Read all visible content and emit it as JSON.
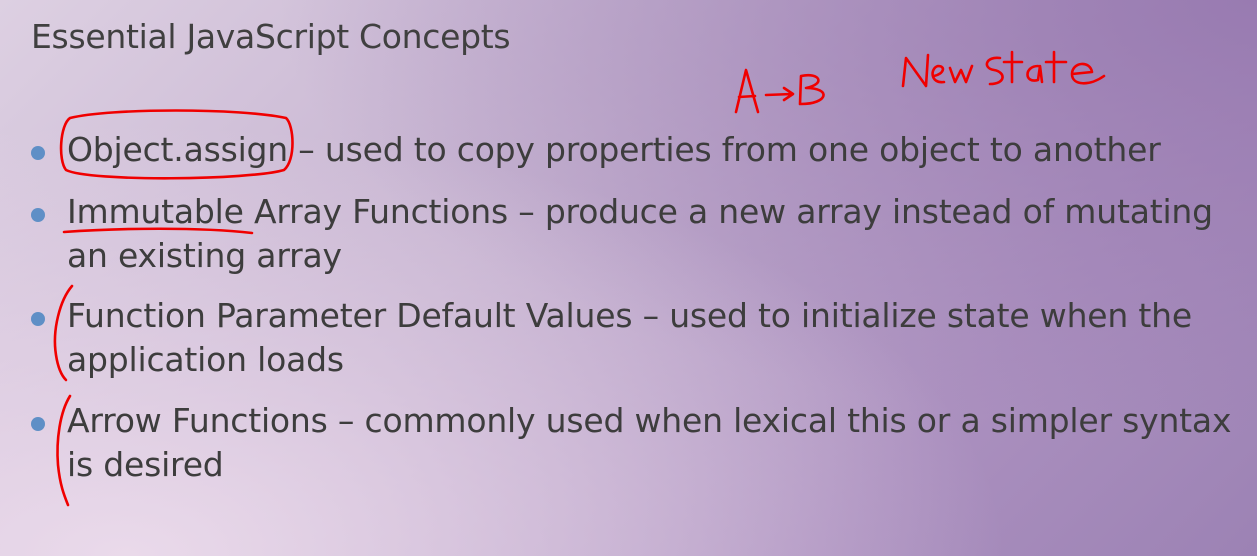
{
  "slide": {
    "title": "Essential JavaScript Concepts",
    "bullets": [
      {
        "line1": "Object.assign – used to copy properties from one object to another",
        "line2": ""
      },
      {
        "line1": "Immutable Array Functions – produce a new array instead of mutating",
        "line2": "an existing array"
      },
      {
        "line1": "Function Parameter Default Values – used to initialize state when the",
        "line2": "application loads"
      },
      {
        "line1": "Arrow Functions – commonly used when lexical this or a simpler syntax",
        "line2": "is desired"
      }
    ],
    "annotations": {
      "arrow_note": "A→B",
      "state_note": "New State"
    }
  },
  "colors": {
    "bullet_dot": "#5f8fc6",
    "text": "#3d3d3d",
    "ink": "#f00000"
  }
}
